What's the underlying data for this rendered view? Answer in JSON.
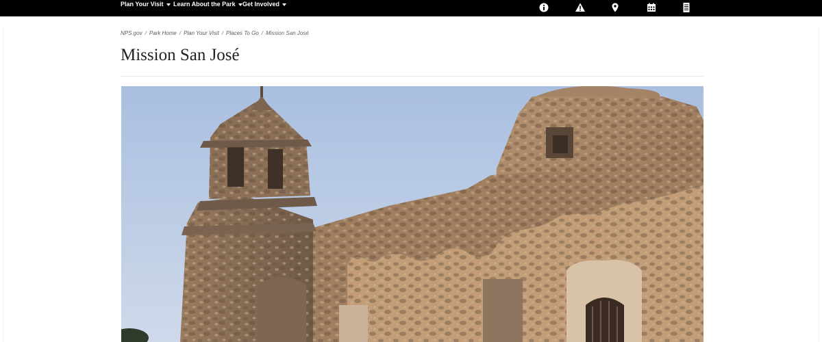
{
  "nav": {
    "items": [
      {
        "label": "Plan Your Visit"
      },
      {
        "label": "Learn About the Park"
      },
      {
        "label": "Get Involved"
      }
    ],
    "icons": [
      "info-icon",
      "alert-icon",
      "map-pin-icon",
      "calendar-icon",
      "document-icon"
    ]
  },
  "breadcrumb": {
    "items": [
      "NPS.gov",
      "Park Home",
      "Plan Your Visit",
      "Places To Go",
      "Mission San José"
    ]
  },
  "page": {
    "title": "Mission San José"
  },
  "colors": {
    "topbar": "#000000",
    "breadcrumb_link": "#595959",
    "title": "#222222",
    "sky": "#b5c7e3",
    "stone": "#b08a67"
  }
}
